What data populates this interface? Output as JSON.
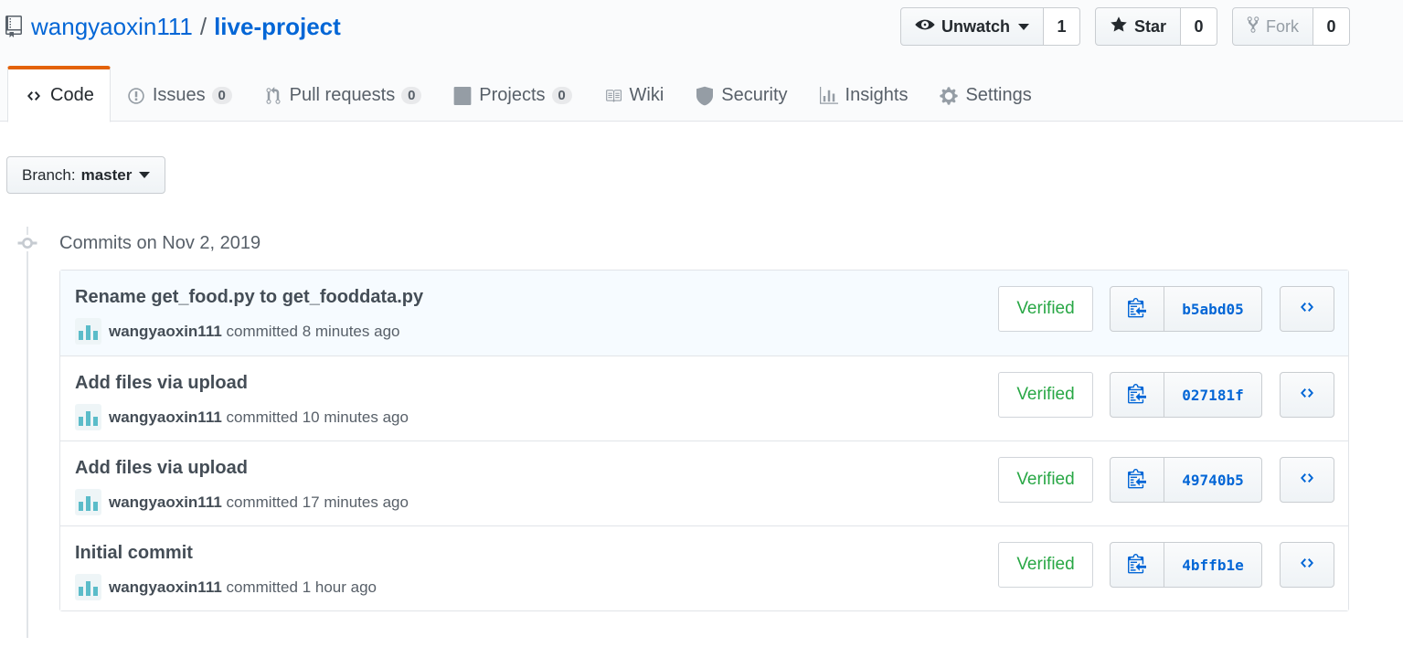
{
  "repo": {
    "owner": "wangyaoxin111",
    "separator": "/",
    "name": "live-project"
  },
  "actions": {
    "watch_label": "Unwatch",
    "watch_count": "1",
    "star_label": "Star",
    "star_count": "0",
    "fork_label": "Fork",
    "fork_count": "0"
  },
  "nav": {
    "tabs": [
      {
        "label": "Code",
        "icon": "code-icon",
        "selected": true
      },
      {
        "label": "Issues",
        "count": "0",
        "icon": "issue-opened-icon"
      },
      {
        "label": "Pull requests",
        "count": "0",
        "icon": "git-pull-request-icon"
      },
      {
        "label": "Projects",
        "count": "0",
        "icon": "project-icon"
      },
      {
        "label": "Wiki",
        "icon": "book-icon"
      },
      {
        "label": "Security",
        "icon": "shield-icon"
      },
      {
        "label": "Insights",
        "icon": "graph-icon"
      },
      {
        "label": "Settings",
        "icon": "gear-icon"
      }
    ]
  },
  "branch": {
    "prefix": "Branch:",
    "name": "master"
  },
  "commit_group": {
    "title": "Commits on Nov 2, 2019"
  },
  "commits": [
    {
      "title": "Rename get_food.py to get_fooddata.py",
      "author": "wangyaoxin111",
      "action": "committed",
      "time": "8 minutes ago",
      "verified": "Verified",
      "sha": "b5abd05"
    },
    {
      "title": "Add files via upload",
      "author": "wangyaoxin111",
      "action": "committed",
      "time": "10 minutes ago",
      "verified": "Verified",
      "sha": "027181f"
    },
    {
      "title": "Add files via upload",
      "author": "wangyaoxin111",
      "action": "committed",
      "time": "17 minutes ago",
      "verified": "Verified",
      "sha": "49740b5"
    },
    {
      "title": "Initial commit",
      "author": "wangyaoxin111",
      "action": "committed",
      "time": "1 hour ago",
      "verified": "Verified",
      "sha": "4bffb1e"
    }
  ],
  "colors": {
    "link": "#0366d6",
    "verified": "#28a745",
    "tab_accent": "#e36209",
    "avatar": "#5bbcc9"
  }
}
